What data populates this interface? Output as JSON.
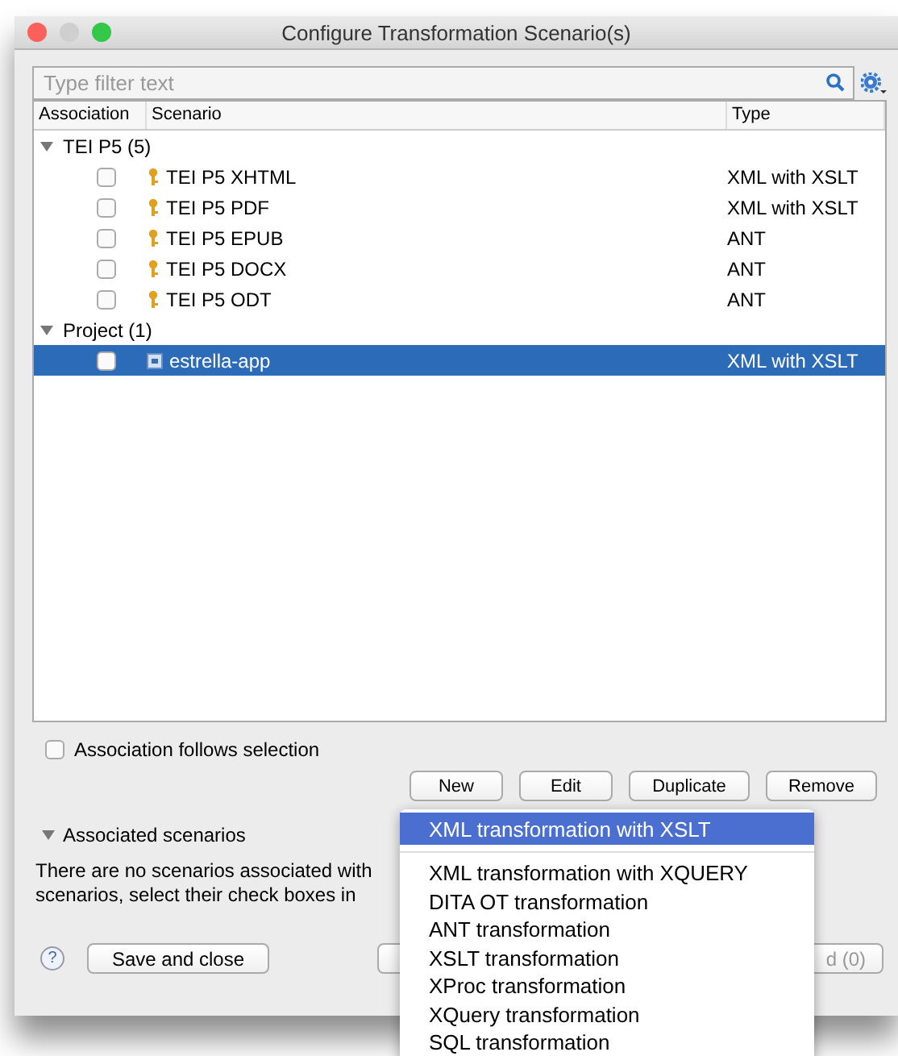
{
  "window": {
    "title": "Configure Transformation Scenario(s)"
  },
  "filter": {
    "placeholder": "Type filter text"
  },
  "table": {
    "columns": [
      "Association",
      "Scenario",
      "Type"
    ],
    "groups": [
      {
        "label": "TEI P5 (5)",
        "expanded": true,
        "rows": [
          {
            "name": "TEI P5 XHTML",
            "type": "XML with XSLT",
            "checked": false,
            "selected": false,
            "kind": "key"
          },
          {
            "name": "TEI P5 PDF",
            "type": "XML with XSLT",
            "checked": false,
            "selected": false,
            "kind": "key"
          },
          {
            "name": "TEI P5 EPUB",
            "type": "ANT",
            "checked": false,
            "selected": false,
            "kind": "key"
          },
          {
            "name": "TEI P5 DOCX",
            "type": "ANT",
            "checked": false,
            "selected": false,
            "kind": "key"
          },
          {
            "name": "TEI P5 ODT",
            "type": "ANT",
            "checked": false,
            "selected": false,
            "kind": "key"
          }
        ]
      },
      {
        "label": "Project (1)",
        "expanded": true,
        "rows": [
          {
            "name": "estrella-app",
            "type": "XML with XSLT",
            "checked": false,
            "selected": true,
            "kind": "project"
          }
        ]
      }
    ]
  },
  "follow_selection": {
    "label": "Association follows selection",
    "checked": false
  },
  "buttons": [
    "New",
    "Edit",
    "Duplicate",
    "Remove"
  ],
  "associated": {
    "title": "Associated scenarios",
    "expanded": true,
    "lines": [
      "There are no scenarios associated with",
      "scenarios, select their check boxes in"
    ]
  },
  "footer": {
    "help": "?",
    "save": "Save and close",
    "apply": "d (0)"
  },
  "menu": {
    "items": [
      {
        "label": "XML transformation with XSLT",
        "selected": true,
        "separator_after": true
      },
      {
        "label": "XML transformation with XQUERY",
        "selected": false
      },
      {
        "label": "DITA OT transformation",
        "selected": false
      },
      {
        "label": "ANT transformation",
        "selected": false
      },
      {
        "label": "XSLT transformation",
        "selected": false
      },
      {
        "label": "XProc transformation",
        "selected": false
      },
      {
        "label": "XQuery transformation",
        "selected": false
      },
      {
        "label": "SQL transformation",
        "selected": false
      }
    ]
  }
}
